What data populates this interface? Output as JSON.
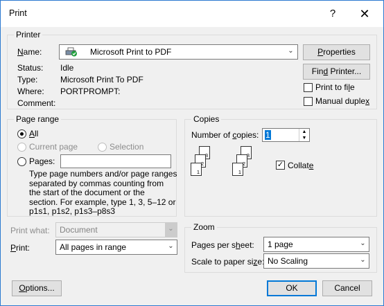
{
  "window": {
    "title": "Print",
    "help_glyph": "?",
    "close_glyph": "✕"
  },
  "printer": {
    "group_label": "Printer",
    "name_label": "Name:",
    "name_value": "Microsoft Print to PDF",
    "status_label": "Status:",
    "status_value": "Idle",
    "type_label": "Type:",
    "type_value": "Microsoft Print To PDF",
    "where_label": "Where:",
    "where_value": "PORTPROMPT:",
    "comment_label": "Comment:",
    "comment_value": "",
    "properties_button": "Properties",
    "find_printer_button": "Find Printer...",
    "print_to_file": "Print to file",
    "manual_duplex": "Manual duplex",
    "printer_icon": "printer-icon"
  },
  "page_range": {
    "group_label": "Page range",
    "all": "All",
    "current_page": "Current page",
    "selection": "Selection",
    "pages": "Pages:",
    "help_lines": [
      "Type page numbers and/or page ranges",
      "separated by commas counting from",
      "the start of the document or the",
      "section. For example, type 1, 3, 5–12 or",
      "p1s1, p1s2, p1s3–p8s3"
    ]
  },
  "copies": {
    "group_label": "Copies",
    "number_label": "Number of copies:",
    "number_value": "1",
    "collate": "Collate",
    "collate_checked": true,
    "stack_numbers": [
      "3",
      "2",
      "1"
    ]
  },
  "print_what": {
    "label": "Print what:",
    "value": "Document"
  },
  "print": {
    "label": "Print:",
    "value": "All pages in range"
  },
  "zoom": {
    "group_label": "Zoom",
    "pages_per_sheet_label": "Pages per sheet:",
    "pages_per_sheet_value": "1 page",
    "scale_label": "Scale to paper size:",
    "scale_value": "No Scaling"
  },
  "footer": {
    "options": "Options...",
    "ok": "OK",
    "cancel": "Cancel"
  },
  "colors": {
    "accent": "#0078d7",
    "window_border": "#2b79d0",
    "face": "#f0f0f0"
  }
}
